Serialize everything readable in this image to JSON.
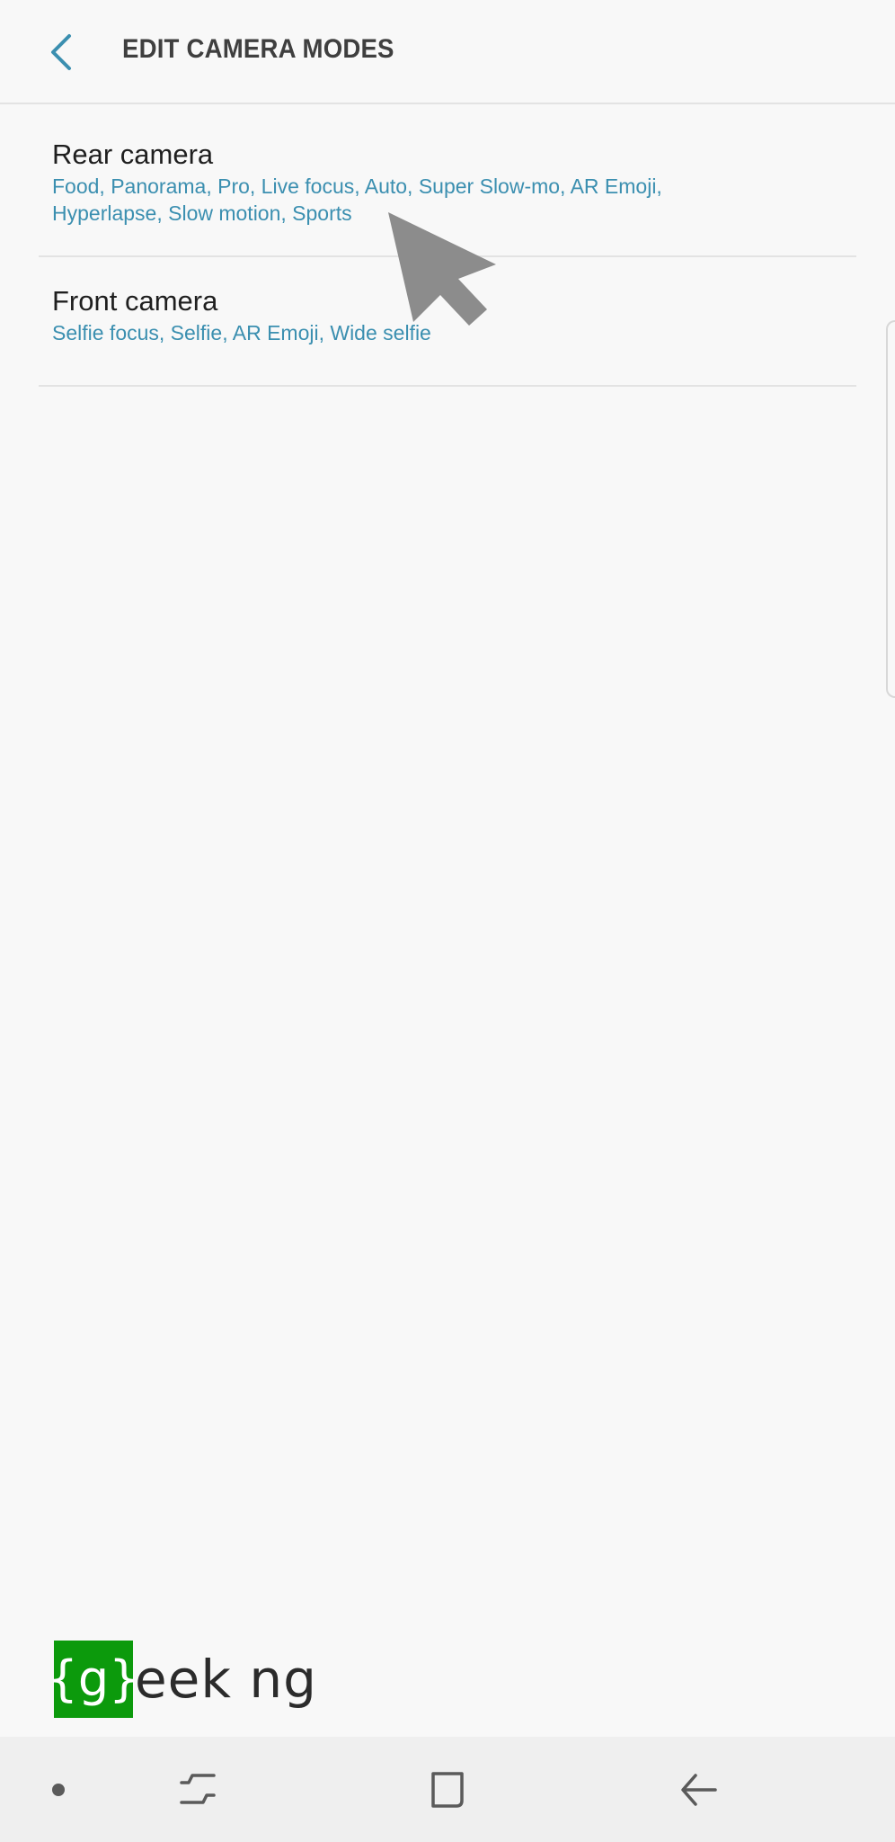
{
  "header": {
    "title": "EDIT CAMERA MODES",
    "back_icon": "chevron-left-icon",
    "accent_color": "#3b8fb0"
  },
  "camera_list": [
    {
      "title": "Rear camera",
      "modes": "Food, Panorama, Pro, Live focus, Auto, Super Slow-mo, AR Emoji, Hyperlapse, Slow motion, Sports"
    },
    {
      "title": "Front camera",
      "modes": "Selfie focus, Selfie, AR Emoji, Wide selfie"
    }
  ],
  "watermark": {
    "boxed_text": "{g}",
    "text": "eek ng",
    "box_color": "#0c9a0c"
  },
  "nav_bar": {
    "items": [
      "dot-icon",
      "recent-apps-icon",
      "home-icon",
      "back-arrow-icon"
    ]
  }
}
